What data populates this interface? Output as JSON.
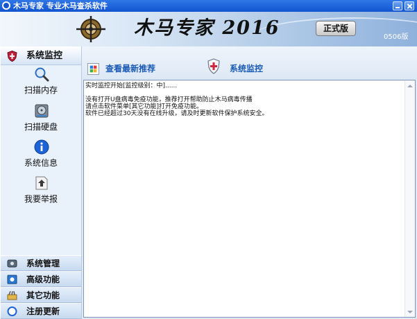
{
  "window": {
    "title": "木马专家  专业木马查杀软件",
    "icons": {
      "app": "app-logo-icon",
      "minimize": "minimize-icon",
      "close": "close-icon"
    }
  },
  "banner": {
    "product_name": "木马专家 2016",
    "edition": "正式版",
    "version": "0506版",
    "icon": "crosshair-logo-icon"
  },
  "sidebar": {
    "section_title": "系统监控",
    "section_icon": "shield-icon",
    "tools": [
      {
        "label": "扫描内存",
        "icon": "magnifier-icon"
      },
      {
        "label": "扫描硬盘",
        "icon": "disk-icon"
      },
      {
        "label": "系统信息",
        "icon": "info-icon"
      },
      {
        "label": "我要举报",
        "icon": "report-icon"
      }
    ],
    "nav": [
      {
        "label": "系统管理",
        "icon": "manage-icon"
      },
      {
        "label": "高级功能",
        "icon": "advanced-icon"
      },
      {
        "label": "其它功能",
        "icon": "tools-icon"
      },
      {
        "label": "注册更新",
        "icon": "register-icon"
      }
    ]
  },
  "content": {
    "recommend_link": "查看最新推荐",
    "tab_label": "系统监控",
    "log_lines": [
      "实时监控开始[监控级别：中]......",
      "",
      "没有打开U盘病毒免疫功能，推荐打开帮助防止木马病毒传播",
      "请点击软件菜单[其它功能]打开免疫功能。",
      "软件已经超过30天没有在线升级，请及时更新软件保护系统安全。"
    ]
  },
  "colors": {
    "titlebar": "#1a5fd6",
    "link": "#1b5bb5",
    "sidebar_bg": "#e9f1fb",
    "nav_bg": "#c8daf0"
  }
}
